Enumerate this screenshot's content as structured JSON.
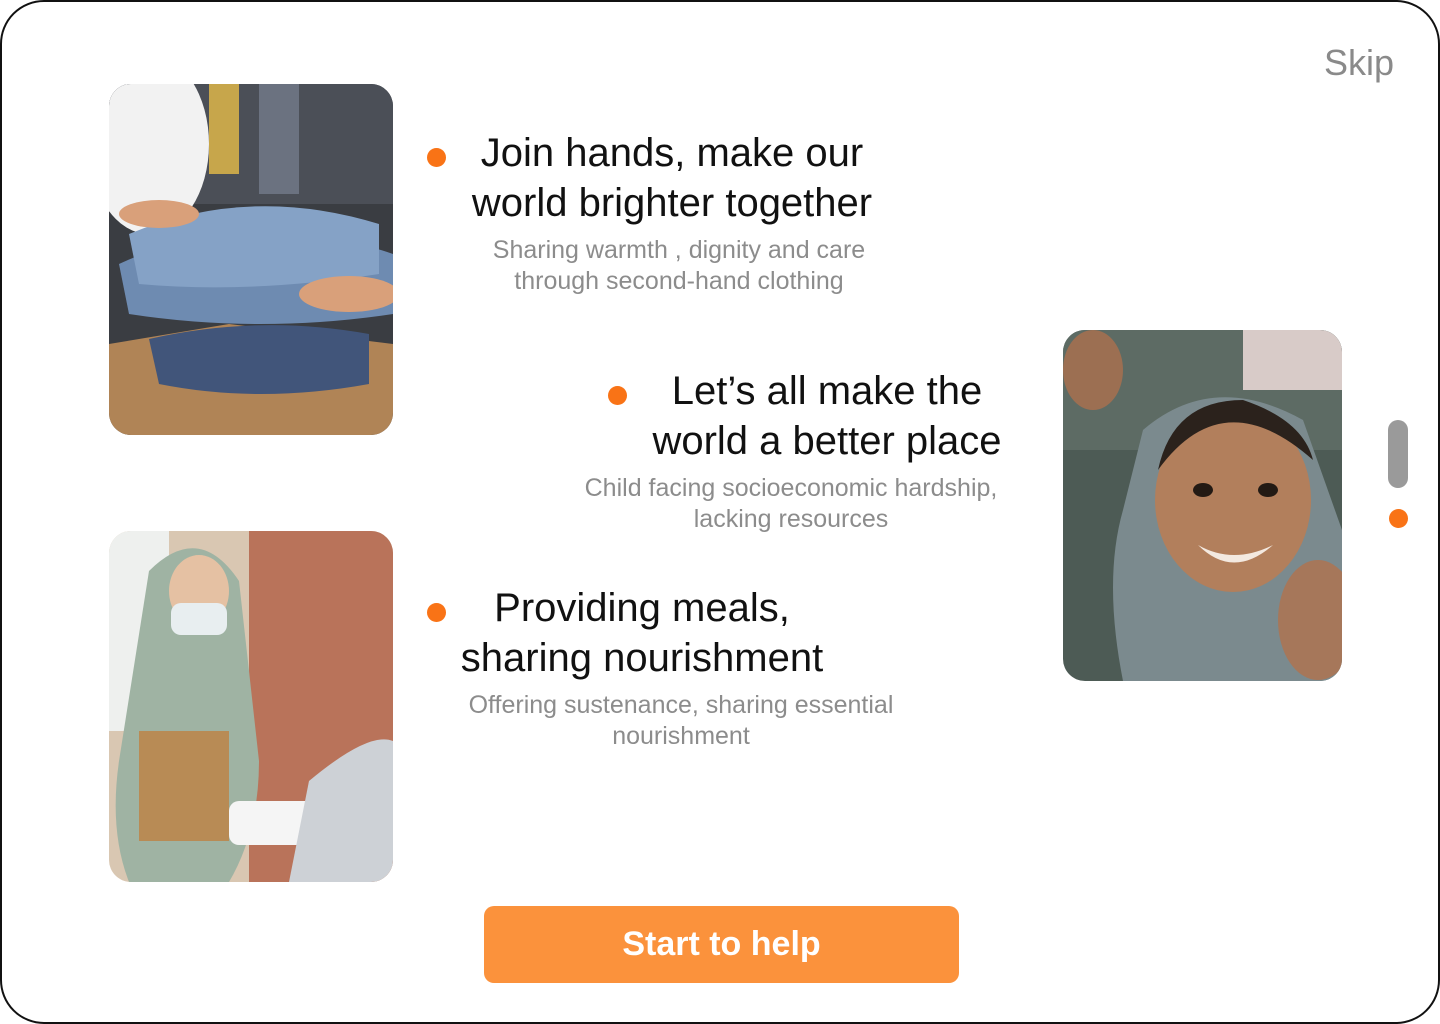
{
  "colors": {
    "accent": "#f97316",
    "button": "#fb923c",
    "muted_text": "#8c8c8c"
  },
  "header": {
    "skip_label": "Skip"
  },
  "photos": [
    {
      "name": "photo-clothes-donation",
      "description_icon": "image-icon"
    },
    {
      "name": "photo-meal-sharing",
      "description_icon": "image-icon"
    },
    {
      "name": "photo-smiling-child",
      "description_icon": "image-icon"
    }
  ],
  "items": [
    {
      "title": "Join hands, make our\nworld brighter together",
      "subtitle": "Sharing warmth , dignity and care\nthrough second-hand clothing"
    },
    {
      "title": "Let’s all make the\nworld a better place",
      "subtitle": "Child facing socioeconomic hardship,\nlacking resources"
    },
    {
      "title": "Providing meals,\nsharing nourishment",
      "subtitle": "Offering sustenance, sharing essential\nnourishment"
    }
  ],
  "cta": {
    "label": "Start to help"
  }
}
